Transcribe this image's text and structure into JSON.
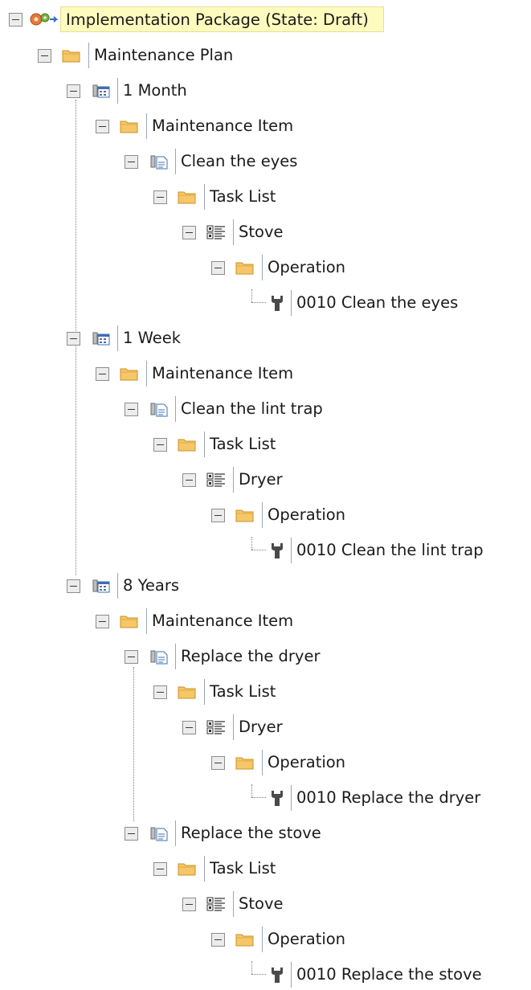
{
  "tree": {
    "root": {
      "label": "Implementation Package (State: Draft)",
      "icon": "implementation-package-icon"
    },
    "nodes": [
      {
        "label": "Maintenance Plan",
        "icon": "folder-icon"
      },
      {
        "label": "1 Month",
        "icon": "maintenance-strategy-icon"
      },
      {
        "label": "Maintenance Item",
        "icon": "folder-icon"
      },
      {
        "label": "Clean the eyes",
        "icon": "maintenance-item-icon"
      },
      {
        "label": "Task List",
        "icon": "folder-icon"
      },
      {
        "label": "Stove",
        "icon": "task-list-icon"
      },
      {
        "label": "Operation",
        "icon": "folder-icon"
      },
      {
        "label": "0010  Clean the eyes",
        "icon": "wrench-icon"
      },
      {
        "label": "1 Week",
        "icon": "maintenance-strategy-icon"
      },
      {
        "label": "Maintenance Item",
        "icon": "folder-icon"
      },
      {
        "label": "Clean the lint trap",
        "icon": "maintenance-item-icon"
      },
      {
        "label": "Task List",
        "icon": "folder-icon"
      },
      {
        "label": "Dryer",
        "icon": "task-list-icon"
      },
      {
        "label": "Operation",
        "icon": "folder-icon"
      },
      {
        "label": "0010  Clean the lint trap",
        "icon": "wrench-icon"
      },
      {
        "label": "8 Years",
        "icon": "maintenance-strategy-icon"
      },
      {
        "label": "Maintenance Item",
        "icon": "folder-icon"
      },
      {
        "label": "Replace the dryer",
        "icon": "maintenance-item-icon"
      },
      {
        "label": "Task List",
        "icon": "folder-icon"
      },
      {
        "label": "Dryer",
        "icon": "task-list-icon"
      },
      {
        "label": "Operation",
        "icon": "folder-icon"
      },
      {
        "label": "0010  Replace the dryer",
        "icon": "wrench-icon"
      },
      {
        "label": "Replace the stove",
        "icon": "maintenance-item-icon"
      },
      {
        "label": "Task List",
        "icon": "folder-icon"
      },
      {
        "label": "Stove",
        "icon": "task-list-icon"
      },
      {
        "label": "Operation",
        "icon": "folder-icon"
      },
      {
        "label": "0010  Replace the stove",
        "icon": "wrench-icon"
      }
    ]
  },
  "colors": {
    "root_highlight": "#fdfbbe",
    "folder": "#f6c768",
    "connector": "#7d7d7d"
  }
}
